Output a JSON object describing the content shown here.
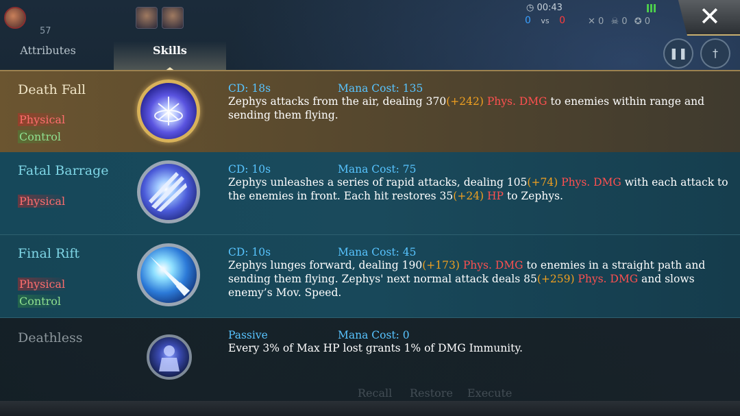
{
  "hud": {
    "level": "57",
    "timer": "00:43",
    "score_blue": "0",
    "score_red": "0",
    "vs": "vs",
    "kills": "0",
    "deaths": "0",
    "assists": "0"
  },
  "tabs": [
    {
      "label": "Attributes",
      "active": false
    },
    {
      "label": "Skills",
      "active": true
    }
  ],
  "close_label": "✕",
  "skills": [
    {
      "name": "Death Fall",
      "tags": [
        "Physical",
        "Control"
      ],
      "cd": "CD: 18s",
      "mana": "Mana Cost: 135",
      "desc": [
        {
          "t": "Zephys attacks from the air, dealing 370",
          "c": ""
        },
        {
          "t": "(+242)",
          "c": "gold"
        },
        {
          "t": " Phys. DMG",
          "c": "red"
        },
        {
          "t": " to enemies within range and sending them flying.",
          "c": ""
        }
      ]
    },
    {
      "name": "Fatal Barrage",
      "tags": [
        "Physical"
      ],
      "cd": "CD: 10s",
      "mana": "Mana Cost: 75",
      "desc": [
        {
          "t": "Zephys unleashes a series of rapid attacks, dealing 105",
          "c": ""
        },
        {
          "t": "(+74)",
          "c": "gold"
        },
        {
          "t": " Phys. DMG",
          "c": "red"
        },
        {
          "t": " with each attack to the enemies in front. Each hit restores 35",
          "c": ""
        },
        {
          "t": "(+24)",
          "c": "gold"
        },
        {
          "t": " HP",
          "c": "red"
        },
        {
          "t": " to Zephys.",
          "c": ""
        }
      ]
    },
    {
      "name": "Final Rift",
      "tags": [
        "Physical",
        "Control"
      ],
      "cd": "CD: 10s",
      "mana": "Mana Cost: 45",
      "desc": [
        {
          "t": "Zephys lunges forward, dealing 190",
          "c": ""
        },
        {
          "t": "(+173)",
          "c": "gold"
        },
        {
          "t": " Phys. DMG",
          "c": "red"
        },
        {
          "t": " to enemies in a straight path and sending them flying. Zephys' next normal attack deals 85",
          "c": ""
        },
        {
          "t": "(+259)",
          "c": "gold"
        },
        {
          "t": " Phys. DMG",
          "c": "red"
        },
        {
          "t": " and slows enemy’s Mov. Speed.",
          "c": ""
        }
      ]
    },
    {
      "name": "Deathless",
      "tags": [],
      "cd": "Passive",
      "mana": "Mana Cost: 0",
      "desc": [
        {
          "t": "Every 3% of Max HP lost grants 1% of DMG Immunity.",
          "c": ""
        }
      ]
    }
  ],
  "background_labels": [
    "Recall",
    "Restore",
    "Execute"
  ],
  "icons": {
    "skill1": "meteor-burst-icon",
    "skill2": "triple-blade-icon",
    "skill3": "lance-thrust-icon",
    "passive": "armored-knight-icon"
  },
  "colors": {
    "cd_mana": "#58c4ff",
    "bonus": "#f0a020",
    "damage": "#ff5050",
    "physical_tag": "#ff6e6e",
    "control_tag": "#8fe08f"
  }
}
